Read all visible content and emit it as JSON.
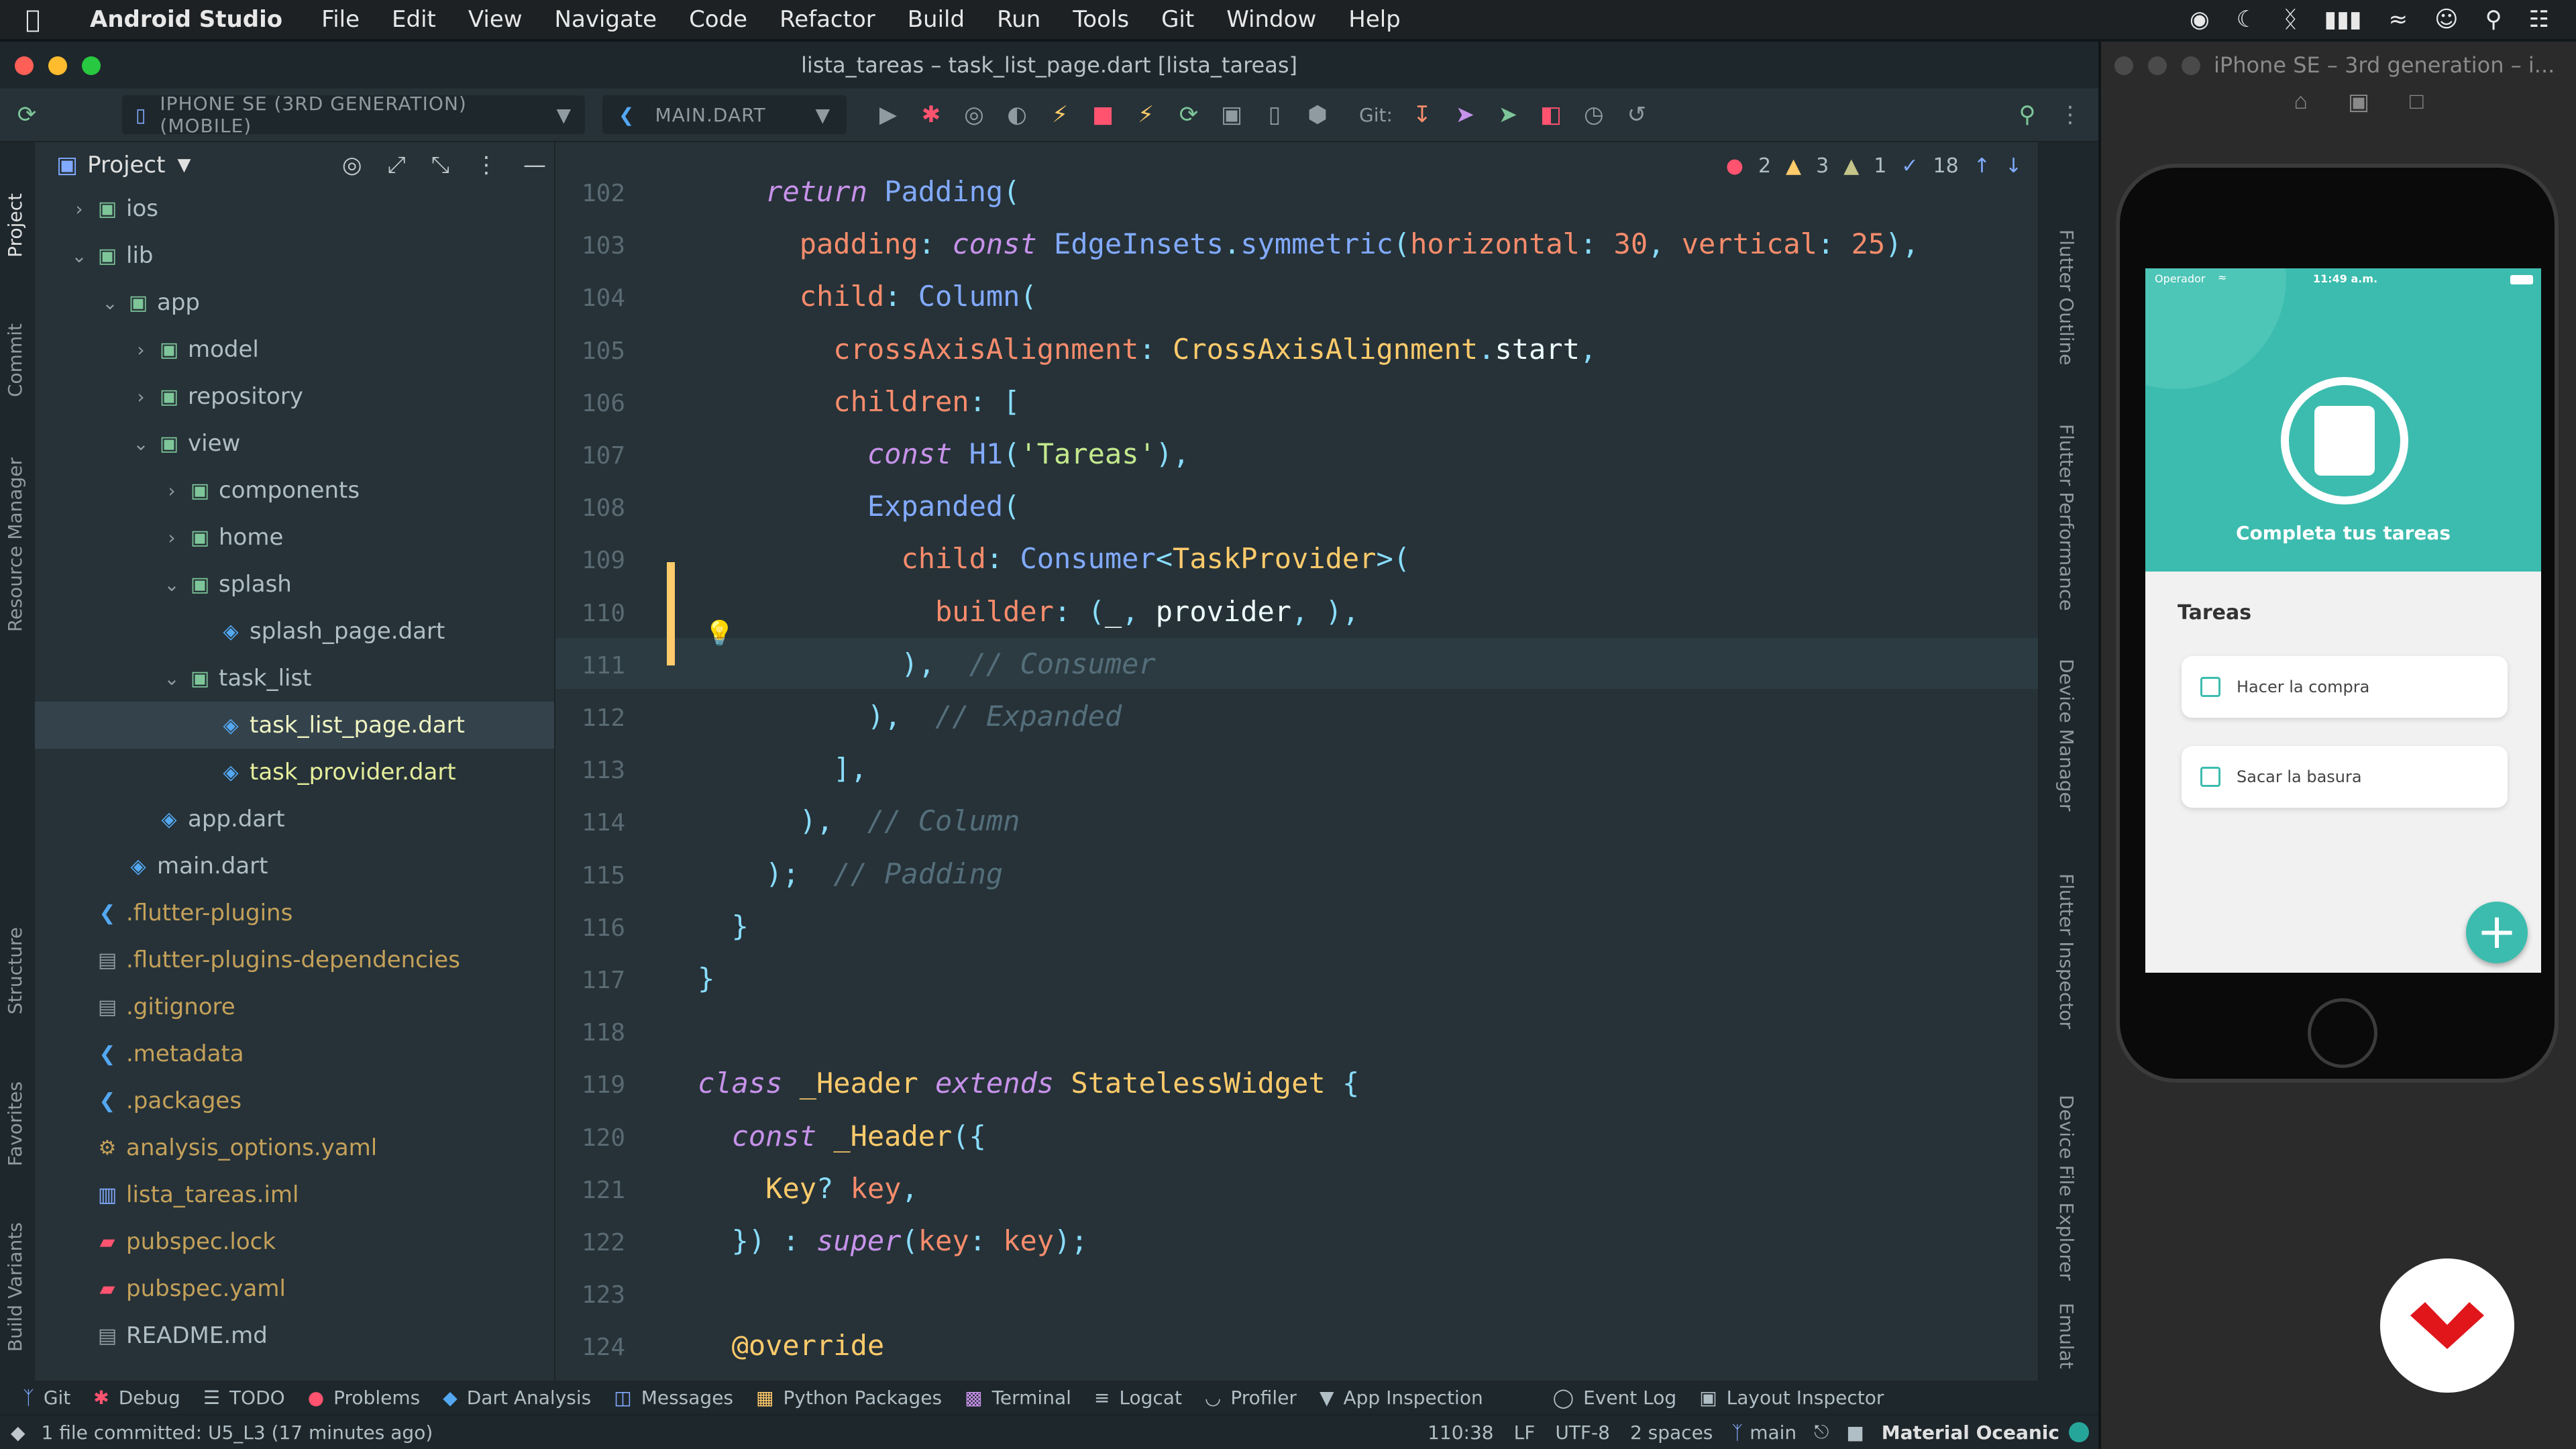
{
  "menubar": {
    "apple": "",
    "app_name": "Android Studio",
    "items": [
      "File",
      "Edit",
      "View",
      "Navigate",
      "Code",
      "Refactor",
      "Build",
      "Run",
      "Tools",
      "Git",
      "Window",
      "Help"
    ]
  },
  "window": {
    "title": "lista_tareas – task_list_page.dart [lista_tareas]"
  },
  "toolbar": {
    "device": "IPHONE SE (3RD GENERATION) (MOBILE)",
    "run_config": "MAIN.DART",
    "git_label": "Git:"
  },
  "left_tabs": [
    "Project",
    "Commit",
    "Resource Manager",
    "Structure",
    "Favorites",
    "Build Variants"
  ],
  "project_panel": {
    "title": "Project",
    "tree": [
      {
        "name": "ios",
        "kind": "folder",
        "color": "#b0bec5"
      },
      {
        "name": "lib",
        "kind": "folder",
        "color": "#b0bec5"
      },
      {
        "name": "app",
        "kind": "folder",
        "color": "#b0bec5"
      },
      {
        "name": "model",
        "kind": "folder",
        "color": "#b0bec5"
      },
      {
        "name": "repository",
        "kind": "folder",
        "color": "#b0bec5"
      },
      {
        "name": "view",
        "kind": "folder",
        "color": "#b0bec5"
      },
      {
        "name": "components",
        "kind": "folder",
        "color": "#b0bec5"
      },
      {
        "name": "home",
        "kind": "folder",
        "color": "#b0bec5"
      },
      {
        "name": "splash",
        "kind": "folder",
        "color": "#b0bec5"
      },
      {
        "name": "splash_page.dart",
        "kind": "dart",
        "color": "#b0bec5"
      },
      {
        "name": "task_list",
        "kind": "folder",
        "color": "#b0bec5"
      },
      {
        "name": "task_list_page.dart",
        "kind": "dart",
        "color": "#f0f4c3"
      },
      {
        "name": "task_provider.dart",
        "kind": "dart",
        "color": "#e6ee9c"
      },
      {
        "name": "app.dart",
        "kind": "dart",
        "color": "#b0bec5"
      },
      {
        "name": "main.dart",
        "kind": "dart",
        "color": "#b0bec5"
      },
      {
        "name": ".flutter-plugins",
        "kind": "flutter",
        "color": "#c5a15a"
      },
      {
        "name": ".flutter-plugins-dependencies",
        "kind": "file",
        "color": "#c5a15a"
      },
      {
        "name": ".gitignore",
        "kind": "file",
        "color": "#c5a15a"
      },
      {
        "name": ".metadata",
        "kind": "flutter",
        "color": "#c5a15a"
      },
      {
        "name": ".packages",
        "kind": "flutter",
        "color": "#c5a15a"
      },
      {
        "name": "analysis_options.yaml",
        "kind": "yaml",
        "color": "#c5a15a"
      },
      {
        "name": "lista_tareas.iml",
        "kind": "iml",
        "color": "#c5a15a"
      },
      {
        "name": "pubspec.lock",
        "kind": "lock",
        "color": "#c5a15a"
      },
      {
        "name": "pubspec.yaml",
        "kind": "lock",
        "color": "#c5a15a"
      },
      {
        "name": "README.md",
        "kind": "file",
        "color": "#b0bec5"
      }
    ]
  },
  "editor": {
    "inspections": {
      "errors": "2",
      "warnings": "3",
      "weak_warnings": "1",
      "typos": "18"
    },
    "lines": [
      {
        "n": "102",
        "tokens": [
          [
            "    ",
            "tx"
          ],
          [
            "return",
            "kw"
          ],
          [
            " ",
            "tx"
          ],
          [
            "Padding",
            "fn"
          ],
          [
            "(",
            "pn"
          ]
        ]
      },
      {
        "n": "103",
        "tokens": [
          [
            "      padding",
            "pr"
          ],
          [
            ": ",
            "pn"
          ],
          [
            "const",
            "kw"
          ],
          [
            " ",
            "tx"
          ],
          [
            "EdgeInsets",
            "fn"
          ],
          [
            ".",
            "pn"
          ],
          [
            "symmetric",
            "fn"
          ],
          [
            "(",
            "pn"
          ],
          [
            "horizontal",
            "pr"
          ],
          [
            ": ",
            "pn"
          ],
          [
            "30",
            "pr"
          ],
          [
            ", ",
            "pn"
          ],
          [
            "vertical",
            "pr"
          ],
          [
            ": ",
            "pn"
          ],
          [
            "25",
            "pr"
          ],
          [
            "),",
            "pn"
          ]
        ]
      },
      {
        "n": "104",
        "tokens": [
          [
            "      child",
            "pr"
          ],
          [
            ": ",
            "pn"
          ],
          [
            "Column",
            "fn"
          ],
          [
            "(",
            "pn"
          ]
        ]
      },
      {
        "n": "105",
        "tokens": [
          [
            "        crossAxisAlignment",
            "pr"
          ],
          [
            ": ",
            "pn"
          ],
          [
            "CrossAxisAlignment",
            "ty"
          ],
          [
            ".",
            "pn"
          ],
          [
            "start",
            "tx"
          ],
          [
            ",",
            "pn"
          ]
        ]
      },
      {
        "n": "106",
        "tokens": [
          [
            "        children",
            "pr"
          ],
          [
            ": [",
            "pn"
          ]
        ]
      },
      {
        "n": "107",
        "tokens": [
          [
            "          ",
            "tx"
          ],
          [
            "const",
            "kw"
          ],
          [
            " ",
            "tx"
          ],
          [
            "H1",
            "fn"
          ],
          [
            "(",
            "pn"
          ],
          [
            "'Tareas'",
            "st"
          ],
          [
            "),",
            "pn"
          ]
        ]
      },
      {
        "n": "108",
        "tokens": [
          [
            "          Expanded",
            "fn"
          ],
          [
            "(",
            "pn"
          ]
        ]
      },
      {
        "n": "109",
        "tokens": [
          [
            "            child",
            "pr"
          ],
          [
            ": ",
            "pn"
          ],
          [
            "Consumer",
            "fn"
          ],
          [
            "<",
            "pn"
          ],
          [
            "TaskProvider",
            "ty"
          ],
          [
            ">(",
            "pn"
          ]
        ]
      },
      {
        "n": "110",
        "tokens": [
          [
            "              builder",
            "pr"
          ],
          [
            ": ",
            "pn"
          ],
          [
            "(",
            "pn"
          ],
          [
            "_",
            "tx"
          ],
          [
            ", ",
            "pn"
          ],
          [
            "provider",
            "tx"
          ],
          [
            ", ",
            "pn"
          ],
          [
            ")",
            "pn"
          ],
          [
            ",",
            "pn"
          ]
        ]
      },
      {
        "n": "111",
        "tokens": [
          [
            "            ), ",
            "pn"
          ],
          [
            " // Consumer",
            "cm"
          ]
        ]
      },
      {
        "n": "112",
        "tokens": [
          [
            "          ), ",
            "pn"
          ],
          [
            " // Expanded",
            "cm"
          ]
        ]
      },
      {
        "n": "113",
        "tokens": [
          [
            "        ],",
            "pn"
          ]
        ]
      },
      {
        "n": "114",
        "tokens": [
          [
            "      ), ",
            "pn"
          ],
          [
            " // Column",
            "cm"
          ]
        ]
      },
      {
        "n": "115",
        "tokens": [
          [
            "    ); ",
            "pn"
          ],
          [
            " // Padding",
            "cm"
          ]
        ]
      },
      {
        "n": "116",
        "tokens": [
          [
            "  }",
            "pn"
          ]
        ]
      },
      {
        "n": "117",
        "tokens": [
          [
            "}",
            "pn"
          ]
        ]
      },
      {
        "n": "118",
        "tokens": [
          [
            "",
            "tx"
          ]
        ]
      },
      {
        "n": "119",
        "tokens": [
          [
            "class",
            "kw"
          ],
          [
            " ",
            "tx"
          ],
          [
            "_Header",
            "ty"
          ],
          [
            " ",
            "tx"
          ],
          [
            "extends",
            "kw"
          ],
          [
            " ",
            "tx"
          ],
          [
            "StatelessWidget",
            "ty"
          ],
          [
            " {",
            "pn"
          ]
        ]
      },
      {
        "n": "120",
        "tokens": [
          [
            "  ",
            "tx"
          ],
          [
            "const",
            "kw"
          ],
          [
            " ",
            "tx"
          ],
          [
            "_Header",
            "ty"
          ],
          [
            "({",
            "pn"
          ]
        ]
      },
      {
        "n": "121",
        "tokens": [
          [
            "    ",
            "tx"
          ],
          [
            "Key",
            "ty"
          ],
          [
            "? ",
            "pn"
          ],
          [
            "key",
            "pr"
          ],
          [
            ",",
            "pn"
          ]
        ]
      },
      {
        "n": "122",
        "tokens": [
          [
            "  }) : ",
            "pn"
          ],
          [
            "super",
            "kw"
          ],
          [
            "(",
            "pn"
          ],
          [
            "key",
            "pr"
          ],
          [
            ": ",
            "pn"
          ],
          [
            "key",
            "pr"
          ],
          [
            ");",
            "pn"
          ]
        ]
      },
      {
        "n": "123",
        "tokens": [
          [
            "",
            "tx"
          ]
        ]
      },
      {
        "n": "124",
        "tokens": [
          [
            "  @override",
            "an"
          ]
        ]
      }
    ]
  },
  "right_tabs": [
    "Flutter Outline",
    "Flutter Performance",
    "Device Manager",
    "Flutter Inspector",
    "Device File Explorer",
    "Emulat"
  ],
  "bottom_tools": [
    "Git",
    "Debug",
    "TODO",
    "Problems",
    "Dart Analysis",
    "Messages",
    "Python Packages",
    "Terminal",
    "Logcat",
    "Profiler",
    "App Inspection",
    "Event Log",
    "Layout Inspector"
  ],
  "statusbar": {
    "message": "1 file committed: U5_L3 (17 minutes ago)",
    "position": "110:38",
    "line_sep": "LF",
    "encoding": "UTF-8",
    "indent": "2 spaces",
    "branch": "main",
    "theme": "Material Oceanic"
  },
  "simulator": {
    "title": "iPhone SE – 3rd generation – i...",
    "status_carrier": "Operador",
    "status_time": "11:49 a.m.",
    "header_title": "Completa tus tareas",
    "section_title": "Tareas",
    "tasks": [
      "Hacer la compra",
      "Sacar la basura"
    ],
    "fab": "+",
    "accent": "#3cbcae"
  }
}
